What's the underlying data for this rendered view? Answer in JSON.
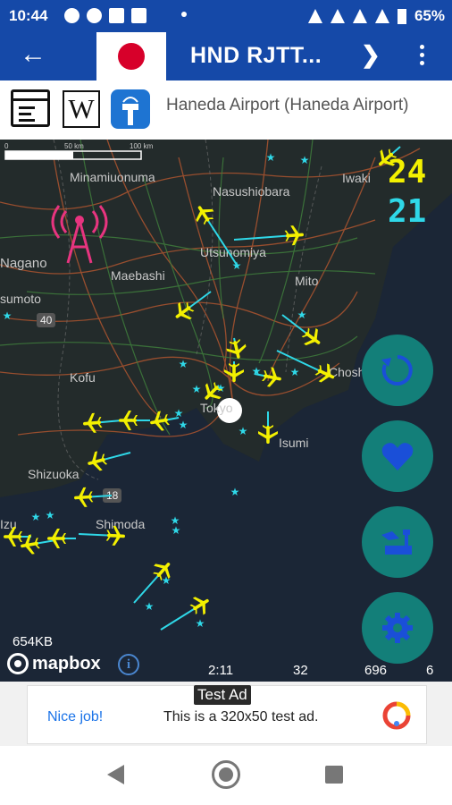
{
  "status_bar": {
    "time": "10:44",
    "battery": "65%",
    "left_icons": [
      "facebook-icon",
      "facebook-icon",
      "mail-icon",
      "photo-icon"
    ],
    "right_icons": [
      "mute-icon",
      "dnd-icon",
      "wifi-icon",
      "signal-icon",
      "battery-icon"
    ]
  },
  "app_bar": {
    "back_icon": "arrow-left-icon",
    "flag": "japan-flag",
    "title": "HND RJTT...",
    "next_icon": "chevron-right-icon",
    "menu_icon": "more-vert-icon",
    "color": "#1549a8"
  },
  "info_bar": {
    "airport_name": "Haneda Airport (Haneda Airport)",
    "icons": [
      "website-icon",
      "wikipedia-icon",
      "airport-tower-icon"
    ]
  },
  "map": {
    "scale_labels": [
      "0",
      "50 km",
      "100 km"
    ],
    "places": [
      {
        "key": "minamiuonuma",
        "label": "Minamiuonuma"
      },
      {
        "key": "nasushiobara",
        "label": "Nasushiobara"
      },
      {
        "key": "iwaki",
        "label": "Iwaki"
      },
      {
        "key": "nagano",
        "label": "Nagano"
      },
      {
        "key": "utsunomiya",
        "label": "Utsunomiya"
      },
      {
        "key": "maebashi",
        "label": "Maebashi"
      },
      {
        "key": "mito",
        "label": "Mito"
      },
      {
        "key": "sumoto",
        "label": "sumoto"
      },
      {
        "key": "kofu",
        "label": "Kofu"
      },
      {
        "key": "choshi",
        "label": "Choshi"
      },
      {
        "key": "tokyo",
        "label": "Tokyo"
      },
      {
        "key": "isumi",
        "label": "Isumi"
      },
      {
        "key": "shizuoka",
        "label": "Shizuoka"
      },
      {
        "key": "shimoda",
        "label": "Shimoda"
      },
      {
        "key": "izu",
        "label": "Izu"
      }
    ],
    "route_badges": [
      "40",
      "18"
    ],
    "arrivals": "24",
    "departures": "21",
    "arrivals_color": "#f3f000",
    "departures_color": "#2fd8e8",
    "data_size": "654KB",
    "attribution": "mapbox",
    "stats": {
      "time": "2:11",
      "a": "32",
      "b": "696",
      "c": "6"
    },
    "fab_buttons": [
      "refresh-icon",
      "favorite-icon",
      "airport-icon",
      "settings-icon"
    ],
    "fab_color": "#137f79",
    "plane_color": "#f3f000",
    "trail_color": "#2fd8e8"
  },
  "ad": {
    "tag": "Test Ad",
    "cta": "Nice job!",
    "text": "This is a 320x50 test ad."
  },
  "nav_bar": {
    "buttons": [
      "back-triangle-icon",
      "home-circle-icon",
      "recents-square-icon"
    ]
  }
}
